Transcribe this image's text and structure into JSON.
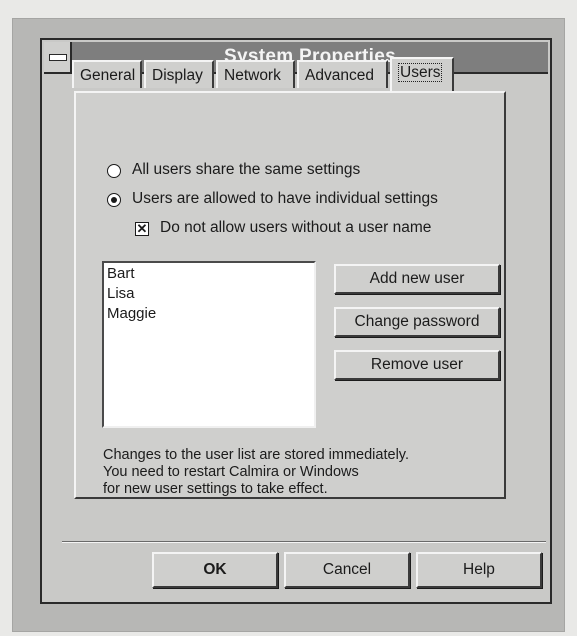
{
  "window": {
    "title": "System Properties"
  },
  "tabs": [
    {
      "label": "General"
    },
    {
      "label": "Display"
    },
    {
      "label": "Network"
    },
    {
      "label": "Advanced"
    },
    {
      "label": "Users",
      "active": true
    }
  ],
  "options": {
    "radio_shared": {
      "label": "All users share the same settings",
      "checked": false
    },
    "radio_individual": {
      "label": "Users are allowed to have individual settings",
      "checked": true
    },
    "checkbox_require_name": {
      "label": "Do not allow users without a user name",
      "checked": true
    }
  },
  "users": [
    "Bart",
    "Lisa",
    "Maggie"
  ],
  "buttons": {
    "add_user": "Add new user",
    "change_password": "Change password",
    "remove_user": "Remove user",
    "ok": "OK",
    "cancel": "Cancel",
    "help": "Help"
  },
  "note": {
    "line1": "Changes to the user list are stored immediately.",
    "line2": "You need to restart Calmira or Windows",
    "line3": "for new user settings to take effect."
  }
}
